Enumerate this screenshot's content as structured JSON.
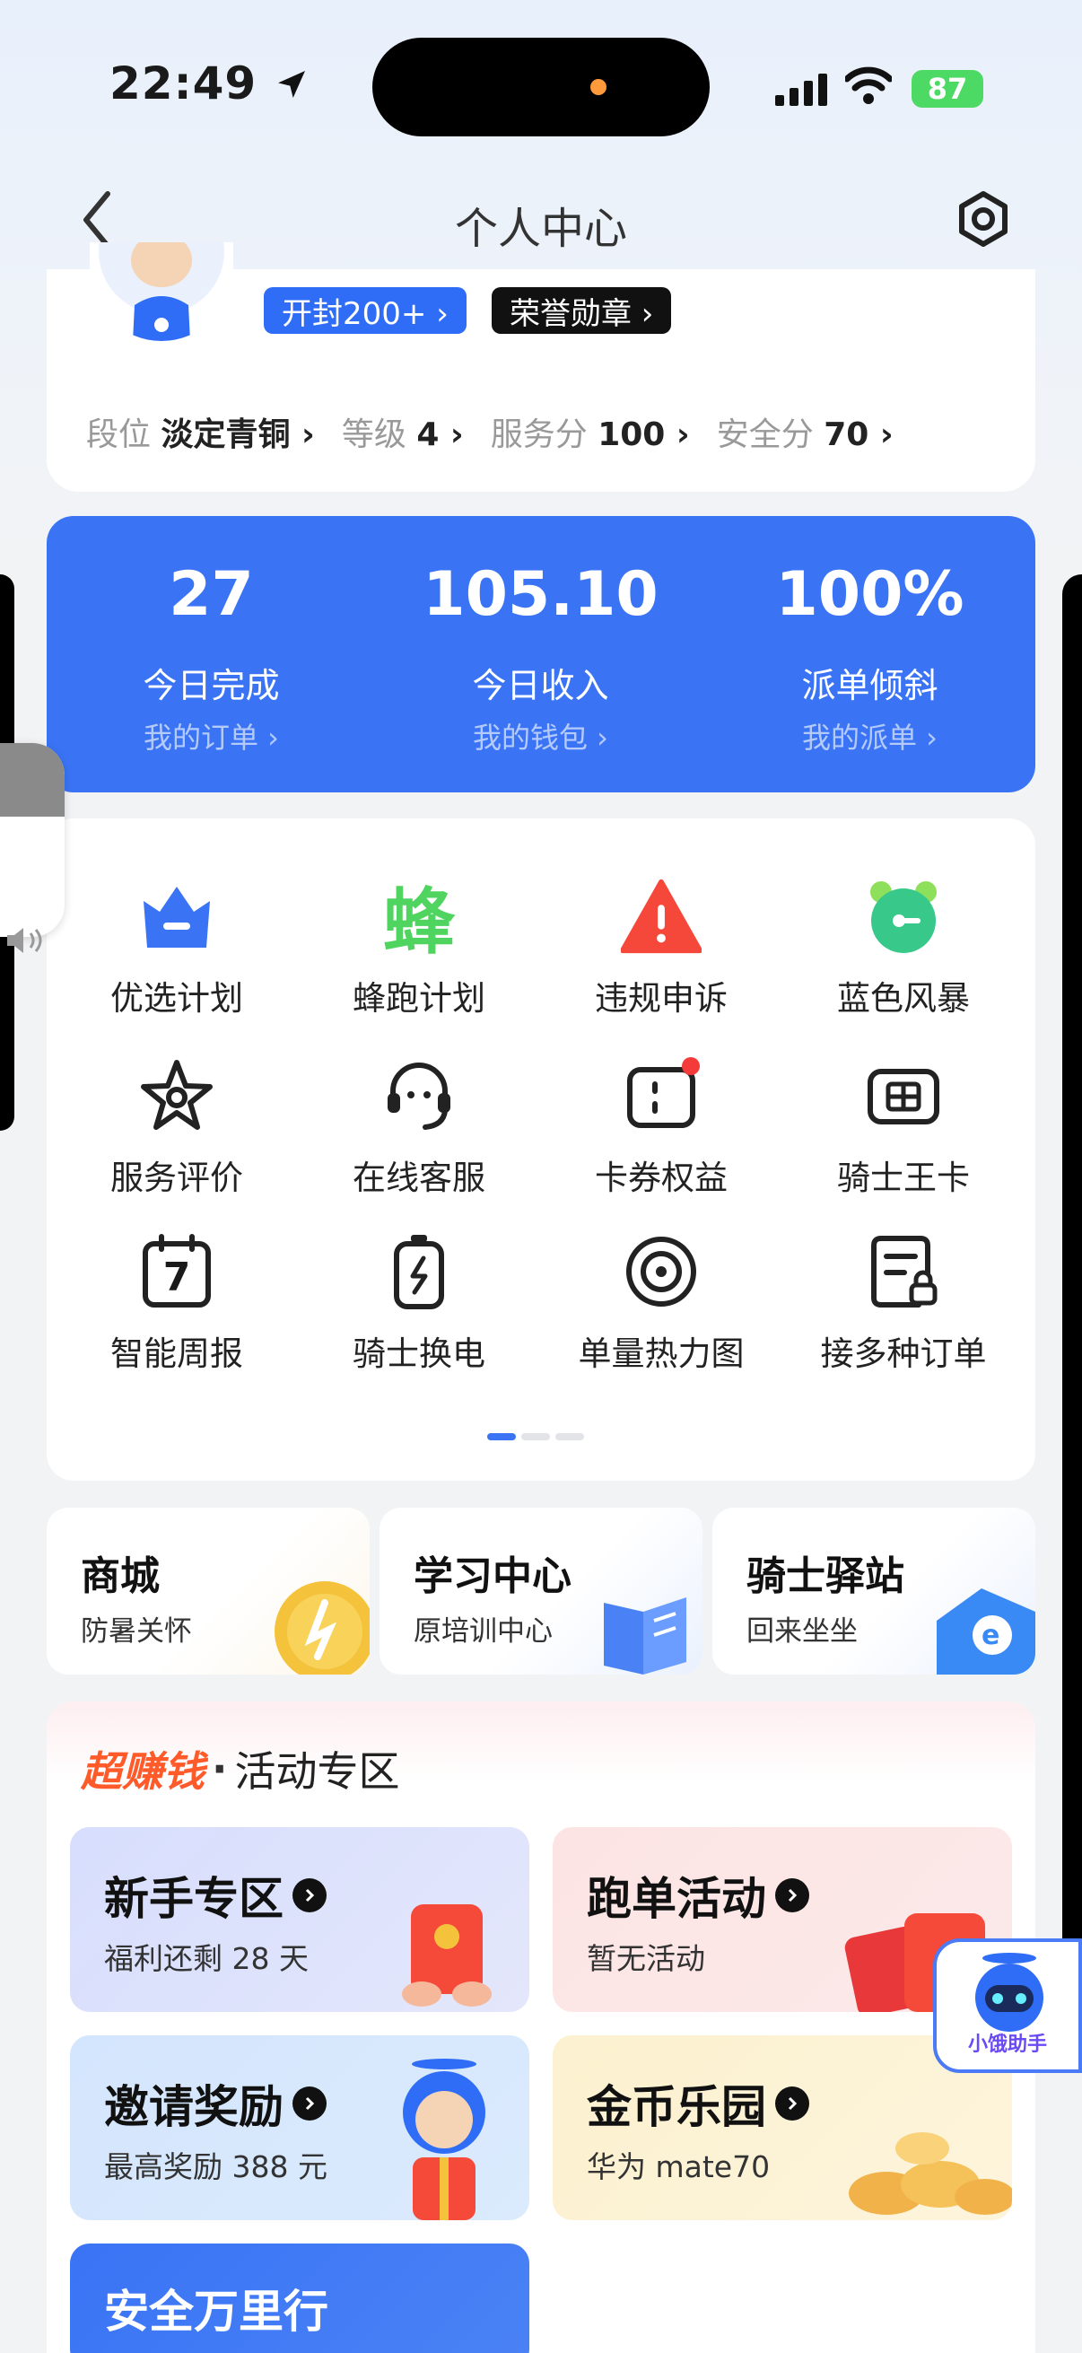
{
  "status_bar": {
    "time": "22:49",
    "battery": "87"
  },
  "nav": {
    "title": "个人中心"
  },
  "profile": {
    "tag_blue": "开封200+ ›",
    "tag_black": "荣誉勋章 ›",
    "stats": [
      {
        "label": "段位",
        "value": "淡定青铜 ›"
      },
      {
        "label": "等级",
        "value": "4 ›"
      },
      {
        "label": "服务分",
        "value": "100 ›"
      },
      {
        "label": "安全分",
        "value": "70 ›"
      }
    ]
  },
  "summary": [
    {
      "value": "27",
      "label": "今日完成",
      "link": "我的订单 ›"
    },
    {
      "value": "105.10",
      "label": "今日收入",
      "link": "我的钱包 ›"
    },
    {
      "value": "100%",
      "label": "派单倾斜",
      "link": "我的派单 ›"
    }
  ],
  "grid": [
    {
      "label": "优选计划",
      "icon": "crown-icon"
    },
    {
      "label": "蜂跑计划",
      "icon": "bee-icon",
      "glyph": "蜂"
    },
    {
      "label": "违规申诉",
      "icon": "warning-icon"
    },
    {
      "label": "蓝色风暴",
      "icon": "alarm-clock-icon"
    },
    {
      "label": "服务评价",
      "icon": "star-icon"
    },
    {
      "label": "在线客服",
      "icon": "headset-icon"
    },
    {
      "label": "卡券权益",
      "icon": "coupon-icon"
    },
    {
      "label": "骑士王卡",
      "icon": "card-icon"
    },
    {
      "label": "智能周报",
      "icon": "calendar-icon",
      "glyph": "7"
    },
    {
      "label": "骑士换电",
      "icon": "battery-swap-icon"
    },
    {
      "label": "单量热力图",
      "icon": "target-icon"
    },
    {
      "label": "接多种订单",
      "icon": "order-doc-icon"
    }
  ],
  "mini_cards": [
    {
      "title": "商城",
      "sub": "防暑关怀"
    },
    {
      "title": "学习中心",
      "sub": "原培训中心"
    },
    {
      "title": "骑士驿站",
      "sub": "回来坐坐"
    }
  ],
  "activity": {
    "hot": "超赚钱",
    "sep": "·",
    "title": "活动专区",
    "tiles": [
      {
        "title": "新手专区",
        "sub": "福利还剩 28 天"
      },
      {
        "title": "跑单活动",
        "sub": "暂无活动"
      },
      {
        "title": "邀请奖励",
        "sub": "最高奖励 388 元"
      },
      {
        "title": "金币乐园",
        "sub": "华为 mate70"
      },
      {
        "title": "安全万里行",
        "sub": ""
      }
    ]
  },
  "helper": {
    "label": "小饿助手"
  },
  "colors": {
    "primary": "#3a74f5",
    "hot": "#ff5a2a"
  }
}
